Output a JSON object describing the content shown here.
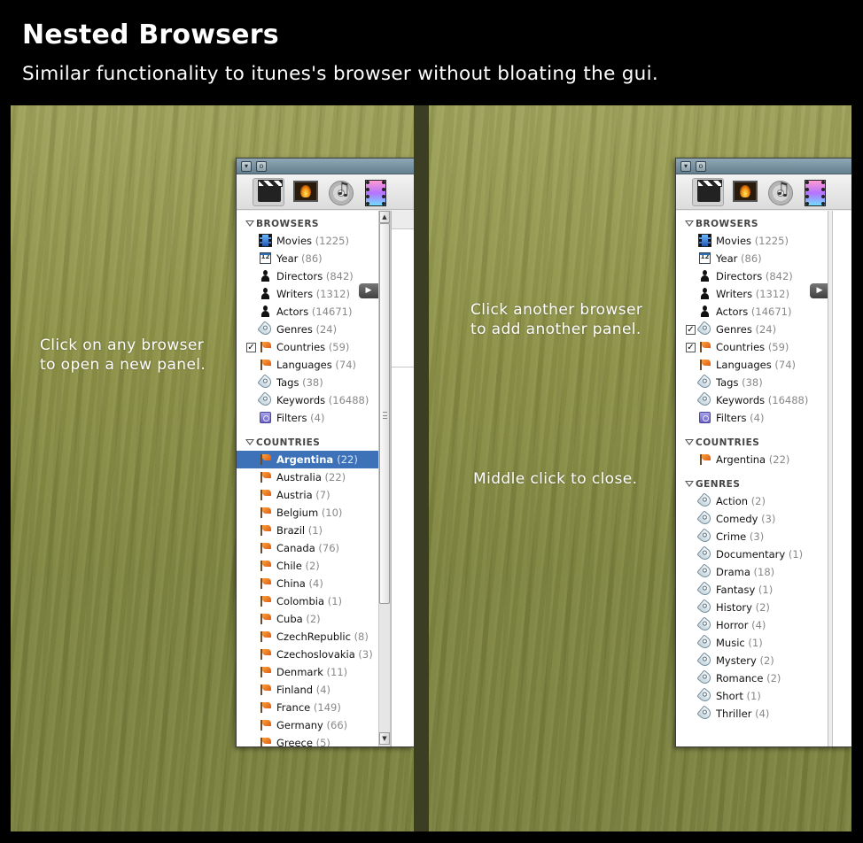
{
  "header": {
    "title": "Nested Browsers",
    "subtitle": "Similar functionality to itunes's browser without bloating the gui."
  },
  "left": {
    "hint": [
      "Click on any browser",
      "to open a new panel."
    ],
    "browsers_header": "BROWSERS",
    "browsers": [
      {
        "label": "Movies",
        "count": "(1225)",
        "icon": "movies-icon",
        "checked": false
      },
      {
        "label": "Year",
        "count": "(86)",
        "icon": "calendar-icon",
        "checked": false
      },
      {
        "label": "Directors",
        "count": "(842)",
        "icon": "person-icon",
        "checked": false
      },
      {
        "label": "Writers",
        "count": "(1312)",
        "icon": "person-icon",
        "checked": false
      },
      {
        "label": "Actors",
        "count": "(14671)",
        "icon": "person-icon",
        "checked": false
      },
      {
        "label": "Genres",
        "count": "(24)",
        "icon": "tag-icon",
        "checked": false
      },
      {
        "label": "Countries",
        "count": "(59)",
        "icon": "flag-icon",
        "checked": true
      },
      {
        "label": "Languages",
        "count": "(74)",
        "icon": "flag-icon",
        "checked": false
      },
      {
        "label": "Tags",
        "count": "(38)",
        "icon": "tag-icon",
        "checked": false
      },
      {
        "label": "Keywords",
        "count": "(16488)",
        "icon": "tag-icon",
        "checked": false
      },
      {
        "label": "Filters",
        "count": "(4)",
        "icon": "filter-icon",
        "checked": false
      }
    ],
    "countries_header": "COUNTRIES",
    "countries": [
      {
        "label": "Argentina",
        "count": "(22)",
        "selected": true
      },
      {
        "label": "Australia",
        "count": "(22)"
      },
      {
        "label": "Austria",
        "count": "(7)"
      },
      {
        "label": "Belgium",
        "count": "(10)"
      },
      {
        "label": "Brazil",
        "count": "(1)"
      },
      {
        "label": "Canada",
        "count": "(76)"
      },
      {
        "label": "Chile",
        "count": "(2)"
      },
      {
        "label": "China",
        "count": "(4)"
      },
      {
        "label": "Colombia",
        "count": "(1)"
      },
      {
        "label": "Cuba",
        "count": "(2)"
      },
      {
        "label": "CzechRepublic",
        "count": "(8)"
      },
      {
        "label": "Czechoslovakia",
        "count": "(3)"
      },
      {
        "label": "Denmark",
        "count": "(11)"
      },
      {
        "label": "Finland",
        "count": "(4)"
      },
      {
        "label": "France",
        "count": "(149)"
      },
      {
        "label": "Germany",
        "count": "(66)"
      },
      {
        "label": "Greece",
        "count": "(5)"
      }
    ]
  },
  "right": {
    "hint1": [
      "Click another browser",
      "to add another panel."
    ],
    "hint2": "Middle click to close.",
    "browsers_header": "BROWSERS",
    "browsers": [
      {
        "label": "Movies",
        "count": "(1225)",
        "icon": "movies-icon",
        "checked": false
      },
      {
        "label": "Year",
        "count": "(86)",
        "icon": "calendar-icon",
        "checked": false
      },
      {
        "label": "Directors",
        "count": "(842)",
        "icon": "person-icon",
        "checked": false
      },
      {
        "label": "Writers",
        "count": "(1312)",
        "icon": "person-icon",
        "checked": false
      },
      {
        "label": "Actors",
        "count": "(14671)",
        "icon": "person-icon",
        "checked": false
      },
      {
        "label": "Genres",
        "count": "(24)",
        "icon": "tag-icon",
        "checked": true
      },
      {
        "label": "Countries",
        "count": "(59)",
        "icon": "flag-icon",
        "checked": true
      },
      {
        "label": "Languages",
        "count": "(74)",
        "icon": "flag-icon",
        "checked": false
      },
      {
        "label": "Tags",
        "count": "(38)",
        "icon": "tag-icon",
        "checked": false
      },
      {
        "label": "Keywords",
        "count": "(16488)",
        "icon": "tag-icon",
        "checked": false
      },
      {
        "label": "Filters",
        "count": "(4)",
        "icon": "filter-icon",
        "checked": false
      }
    ],
    "countries_header": "COUNTRIES",
    "countries": [
      {
        "label": "Argentina",
        "count": "(22)"
      }
    ],
    "genres_header": "GENRES",
    "genres": [
      {
        "label": "Action",
        "count": "(2)"
      },
      {
        "label": "Comedy",
        "count": "(3)"
      },
      {
        "label": "Crime",
        "count": "(3)"
      },
      {
        "label": "Documentary",
        "count": "(1)"
      },
      {
        "label": "Drama",
        "count": "(18)"
      },
      {
        "label": "Fantasy",
        "count": "(1)"
      },
      {
        "label": "History",
        "count": "(2)"
      },
      {
        "label": "Horror",
        "count": "(4)"
      },
      {
        "label": "Music",
        "count": "(1)"
      },
      {
        "label": "Mystery",
        "count": "(2)"
      },
      {
        "label": "Romance",
        "count": "(2)"
      },
      {
        "label": "Short",
        "count": "(1)"
      },
      {
        "label": "Thriller",
        "count": "(4)"
      }
    ]
  },
  "toolbar_icons": [
    "movies-tool-icon",
    "photos-tool-icon",
    "music-tool-icon",
    "video-tool-icon"
  ],
  "colors": {
    "selection": "#3d72b8",
    "titlebar": "#7892a2",
    "desktop": "#8c9147"
  }
}
